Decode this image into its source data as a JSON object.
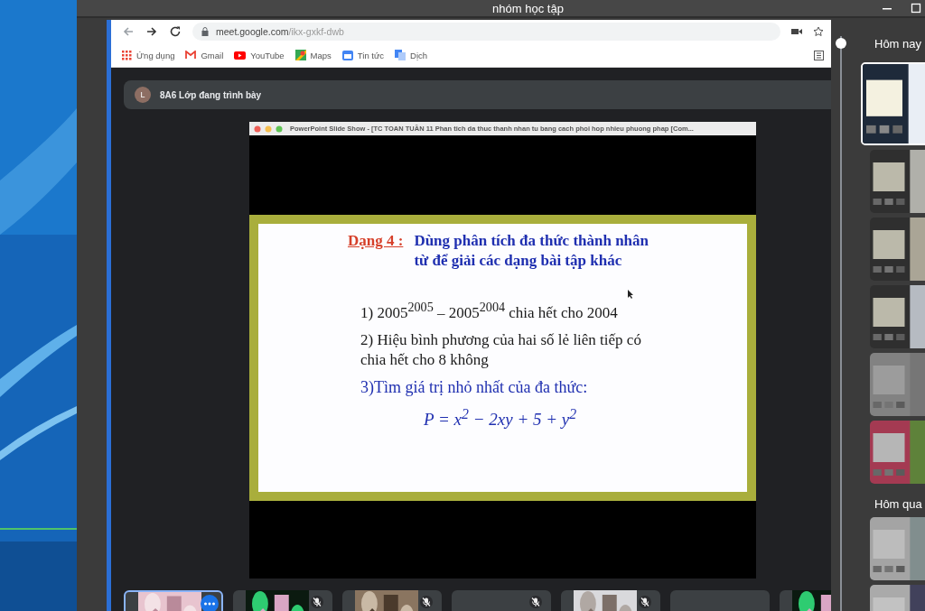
{
  "window": {
    "title": "nhóm học tập"
  },
  "browser": {
    "url_host": "meet.google.com",
    "url_path": "/ikx-gxkf-dwb",
    "bookmarks": [
      {
        "kind": "apps",
        "label": "Ứng dụng"
      },
      {
        "kind": "gmail",
        "label": "Gmail"
      },
      {
        "kind": "youtube",
        "label": "YouTube"
      },
      {
        "kind": "maps",
        "label": "Maps"
      },
      {
        "kind": "news",
        "label": "Tin tức"
      },
      {
        "kind": "translate",
        "label": "Dịch"
      }
    ]
  },
  "meet": {
    "presenter_initial": "L",
    "presenter_text": "8A6 Lớp đang trình bày",
    "slide_window_title": "PowerPoint Slide Show - [TC TOAN TUẦN 11 Phan tich da thuc thanh nhan tu bang cach phoi hop nhieu phuong phap [Com...",
    "slide": {
      "tag": "Dạng 4 :",
      "heading_lines": [
        "Dùng phân tích đa thức thành nhân",
        "từ để giải các dạng bài tập khác"
      ],
      "items": [
        {
          "kind": "black",
          "text": "1) 2005$^{2005}$  – 2005$^{2004}$  chia hết cho 2004"
        },
        {
          "kind": "black",
          "text": "2) Hiệu bình phương của hai số lẻ liên tiếp có  chia hết cho 8  không"
        },
        {
          "kind": "blue",
          "text": "3)Tìm giá trị nhỏ nhất của  đa thức:"
        },
        {
          "kind": "formula",
          "text": "P = x$^{2}$ − 2xy + 5 + y$^{2}$"
        }
      ]
    },
    "participants": [
      {
        "kind": "picture",
        "selected": true,
        "muted": false,
        "more": true
      },
      {
        "kind": "picture",
        "selected": false,
        "muted": true,
        "more": false
      },
      {
        "kind": "picture",
        "selected": false,
        "muted": true,
        "more": false
      },
      {
        "kind": "blank",
        "selected": false,
        "muted": true,
        "more": false
      },
      {
        "kind": "picture",
        "selected": false,
        "muted": true,
        "more": false
      },
      {
        "kind": "blank",
        "selected": false,
        "muted": false,
        "more": false
      },
      {
        "kind": "picture",
        "selected": false,
        "muted": false,
        "more": false
      }
    ]
  },
  "history": [
    {
      "label": "Hôm nay",
      "thumbs": [
        {
          "selected": true
        },
        {
          "selected": false
        },
        {
          "selected": false
        },
        {
          "selected": false
        },
        {
          "selected": false
        },
        {
          "selected": false
        }
      ]
    },
    {
      "label": "Hôm qua",
      "thumbs": [
        {
          "selected": false
        },
        {
          "selected": false
        }
      ]
    }
  ]
}
